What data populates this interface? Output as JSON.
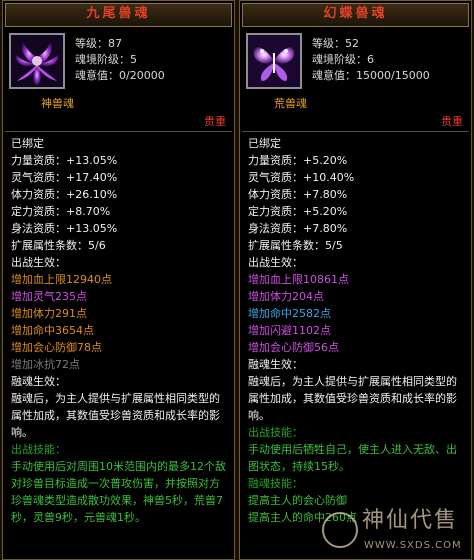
{
  "left": {
    "title": "九尾兽魂",
    "stats": [
      "等级：87",
      "魂境阶级：5",
      "魂意值：0/20000"
    ],
    "type": "神兽魂",
    "rarity": "贵重",
    "bound": "已绑定",
    "attrs": [
      "力量资质：+13.05%",
      "灵气资质：+17.40%",
      "体力资质：+26.10%",
      "定力资质：+8.70%",
      "身法资质：+13.05%"
    ],
    "ext_count": "扩展属性条数：5/6",
    "battle_effect_label": "出战生效：",
    "effects": [
      {
        "text": "增加血上限12940点",
        "color": "orange"
      },
      {
        "text": "增加灵气235点",
        "color": "purple"
      },
      {
        "text": "增加体力291点",
        "color": "orange"
      },
      {
        "text": "增加命中3654点",
        "color": "orange"
      },
      {
        "text": "增加会心防御78点",
        "color": "orange"
      },
      {
        "text": "增加冰抗72点",
        "color": "gray"
      }
    ],
    "fuse_label": "融魂生效：",
    "fuse_desc": "融魂后，为主人提供与扩展属性相同类型的属性加成，其数值受珍兽资质和成长率的影响。",
    "skill_label": "出战技能：",
    "skill_desc": "手动使用后对周围10米范围内的最多12个敌对珍兽目标造成一次普攻伤害，并按照对方珍兽魂类型造成散功效果，神兽5秒，荒兽7秒，灵兽9秒，元兽魂1秒。"
  },
  "right": {
    "title": "幻蝶兽魂",
    "stats": [
      "等级：52",
      "魂境阶级：6",
      "魂意值：15000/15000"
    ],
    "type": "荒兽魂",
    "rarity": "贵重",
    "bound": "已绑定",
    "attrs": [
      "力量资质：+5.20%",
      "灵气资质：+10.40%",
      "体力资质：+7.80%",
      "定力资质：+5.20%",
      "身法资质：+7.80%"
    ],
    "ext_count": "扩展属性条数：5/5",
    "battle_effect_label": "出战生效：",
    "effects": [
      {
        "text": "增加血上限10861点",
        "color": "purple"
      },
      {
        "text": "增加体力204点",
        "color": "purple"
      },
      {
        "text": "增加命中2582点",
        "color": "blue"
      },
      {
        "text": "增加闪避1102点",
        "color": "purple"
      },
      {
        "text": "增加会心防御56点",
        "color": "purple"
      }
    ],
    "fuse_label": "融魂生效：",
    "fuse_desc": "融魂后，为主人提供与扩展属性相同类型的属性加成，其数值受珍兽资质和成长率的影响。",
    "skill_label": "出战技能：",
    "skill_desc": "手动使用后牺牲自己，使主人进入无敌、出图状态，持续15秒。",
    "fuse_skill_label": "融魂技能：",
    "fuse_skill_lines": [
      "提高主人的会心防御",
      "提高主人的命中260点"
    ]
  },
  "watermark": {
    "text": "神仙代售",
    "url": "WWW.SXDS.COM"
  }
}
